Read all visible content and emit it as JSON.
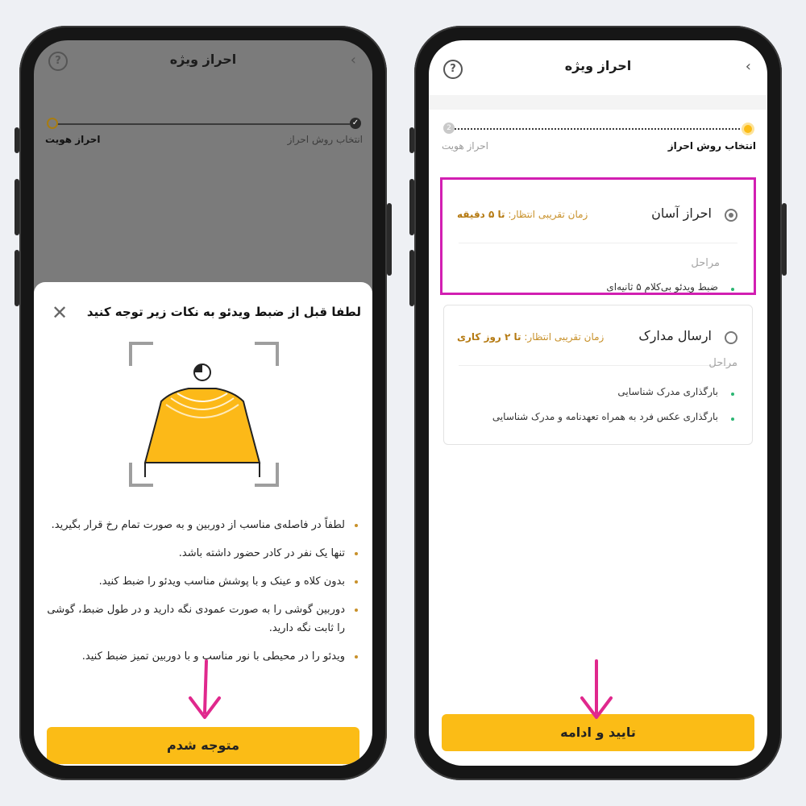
{
  "common": {
    "header_title": "احراز ویژه",
    "back_icon": "chevron-right-icon",
    "help_icon": "help-circle-icon",
    "help_glyph": "?",
    "accent_yellow": "#fbbc16",
    "highlight_magenta": "#d21fb2"
  },
  "left_screen": {
    "steps": [
      {
        "label": "انتخاب روش احراز",
        "state": "done"
      },
      {
        "label": "احراز هویت",
        "state": "current"
      }
    ],
    "sheet": {
      "title": "لطفا قبل از ضبط ویدئو به نکات زیر توجه کنید",
      "close_glyph": "✕",
      "tips": [
        "لطفاً در فاصله‌ی مناسب از دوربین و به صورت تمام رخ قرار بگیرید.",
        "تنها یک نفر در کادر حضور داشته باشد.",
        "بدون کلاه و عینک و با پوشش مناسب ویدئو را ضبط کنید.",
        "دوربین گوشی را به صورت عمودی نگه دارید و در طول ضبط، گوشی را ثابت نگه دارید.",
        "ویدئو را در محیطی با نور مناسب و با دوربین تمیز ضبط کنید."
      ],
      "button_label": "متوجه شدم"
    }
  },
  "right_screen": {
    "steps": [
      {
        "label": "انتخاب روش احراز",
        "state": "current"
      },
      {
        "label": "احراز هویت",
        "number": "2",
        "state": "upcoming"
      }
    ],
    "options": [
      {
        "name": "احراز آسان",
        "selected": true,
        "wait_label": "زمان تقریبی انتظار:",
        "wait_value": "تا ۵ دقیقه",
        "stages_label": "مراحل",
        "stages": [
          "ضبط ویدئو بی‌کلام ۵ ثانیه‌ای"
        ]
      },
      {
        "name": "ارسال مدارک",
        "selected": false,
        "wait_label": "زمان تقریبی انتظار:",
        "wait_value": "تا ۲ روز کاری",
        "stages_label": "مراحل",
        "stages": [
          "بارگذاری مدرک شناسایی",
          "بارگذاری عکس فرد به همراه تعهدنامه و مدرک شناسایی"
        ]
      }
    ],
    "button_label": "تایید و ادامه"
  }
}
